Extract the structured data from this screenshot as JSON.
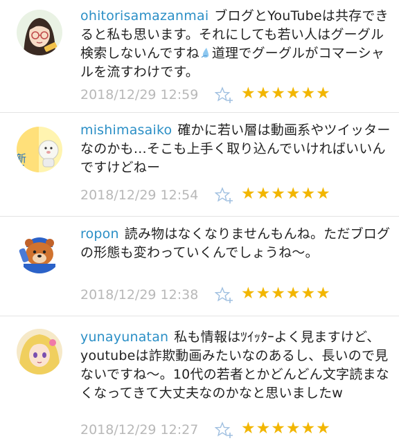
{
  "comments": [
    {
      "username": "ohitorisamazanmai",
      "text_a": "ブログとYouTubeは共存できると私も思います。それにしても若い人はグーグル検索しないんですね",
      "text_b": "道理でグーグルがコマーシャルを流すわけです。",
      "time": "2018/12/29 12:59",
      "stars": "★★★★★★"
    },
    {
      "username": "mishimasaiko",
      "text": "確かに若い層は動画系やツイッターなのかも…そこも上手く取り込んでいければいいんですけどねー",
      "time": "2018/12/29 12:54",
      "stars": "★★★★★★",
      "avatar_label": "新冬"
    },
    {
      "username": "ropon",
      "text": "読み物はなくなりませんもんね。ただブログの形態も変わっていくんでしょうね〜。",
      "time": "2018/12/29 12:38",
      "stars": "★★★★★★"
    },
    {
      "username": "yunayunatan",
      "text": "私も情報はﾂｲｯﾀｰよく見ますけど、youtubeは詐欺動画みたいなのあるし、長いので見ないですね〜。10代の若者とかどんどん文字読まなくなってきて大丈夫なのかなと思いましたw",
      "time": "2018/12/29 12:27",
      "stars": "★★★★★★"
    }
  ],
  "colors": {
    "username": "#2b8fc6",
    "timestamp": "#b8b8b8",
    "star": "#f2b600",
    "star_add": "#9fbfe0"
  },
  "icons": [
    "star-add-icon",
    "water-drop-icon"
  ]
}
